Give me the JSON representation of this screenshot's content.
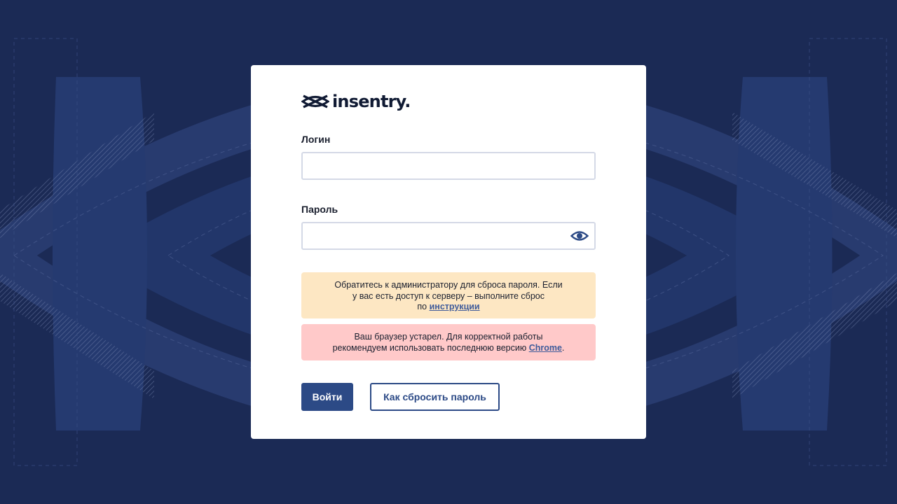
{
  "brand": {
    "name": "insentry."
  },
  "login": {
    "label": "Логин",
    "value": "",
    "placeholder": ""
  },
  "password": {
    "label": "Пароль",
    "value": "",
    "placeholder": ""
  },
  "notices": {
    "reset": {
      "line1": "Обратитесь к администратору для сброса пароля. Если",
      "line2": "у вас есть доступ к серверу – выполните сброс",
      "line3_prefix": "по ",
      "link": "инструкции"
    },
    "browser": {
      "line1": "Ваш браузер устарел. Для корректной работы",
      "line2_prefix": "рекомендуем использовать последнюю версию ",
      "link": "Chrome",
      "line2_suffix": "."
    }
  },
  "actions": {
    "submit_label": "Войти",
    "reset_label": "Как сбросить пароль"
  },
  "icons": {
    "logo": "insentry-eye-logo-icon",
    "password_toggle": "eye-icon"
  },
  "colors": {
    "background": "#1b2a55",
    "primary": "#2c4a86",
    "warning_bg": "#fde7c3",
    "error_bg": "#ffc9c9"
  }
}
